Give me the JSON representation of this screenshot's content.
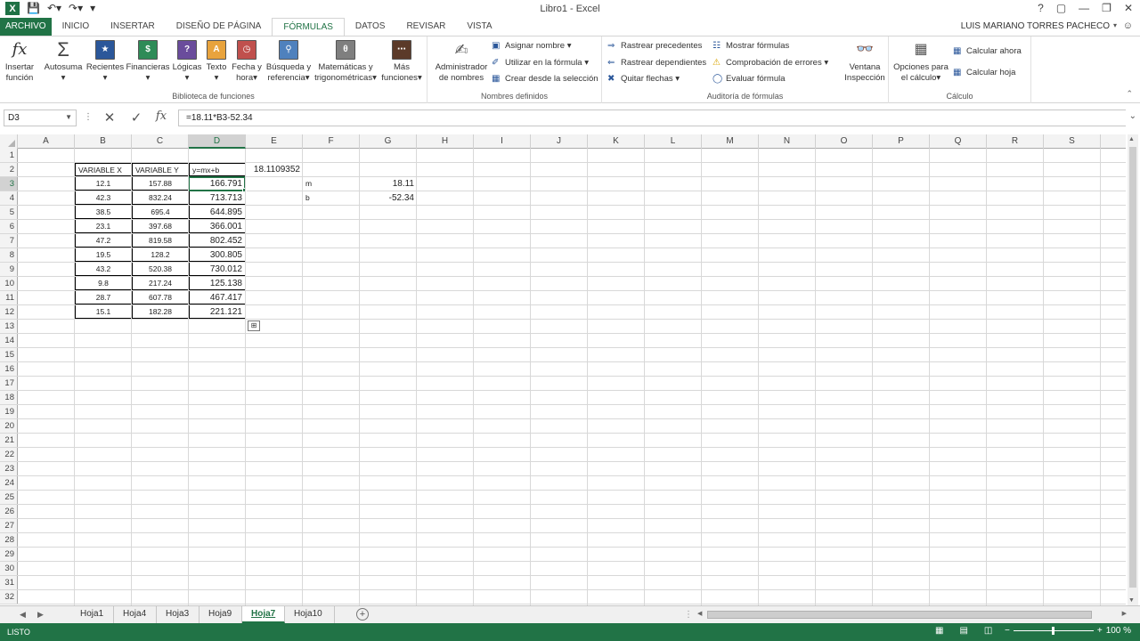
{
  "window": {
    "title": "Libro1 - Excel",
    "controls": [
      "?",
      "▢",
      "—",
      "❐",
      "✕"
    ]
  },
  "qat": {
    "save_icon": "save-icon",
    "undo_icon": "undo-icon",
    "redo_icon": "redo-icon"
  },
  "tabs": {
    "file": "ARCHIVO",
    "items": [
      "INICIO",
      "INSERTAR",
      "DISEÑO DE PÁGINA",
      "FÓRMULAS",
      "DATOS",
      "REVISAR",
      "VISTA"
    ],
    "active": "FÓRMULAS",
    "user": "LUIS MARIANO TORRES PACHECO"
  },
  "ribbon": {
    "biblioteca": {
      "label": "Biblioteca de funciones",
      "insertar": "Insertar función",
      "autosuma": "Autosuma",
      "recientes": "Recientes",
      "financieras": "Financieras",
      "logicas": "Lógicas",
      "texto": "Texto",
      "fecha": "Fecha y hora",
      "busqueda": "Búsqueda y referencia",
      "matematicas": "Matemáticas y trigonométricas",
      "mas": "Más funciones"
    },
    "nombres": {
      "label": "Nombres definidos",
      "administrador": "Administrador de nombres",
      "asignar": "Asignar nombre",
      "utilizar": "Utilizar en la fórmula",
      "crear": "Crear desde la selección"
    },
    "auditoria": {
      "label": "Auditoría de fórmulas",
      "precedentes": "Rastrear precedentes",
      "dependientes": "Rastrear dependientes",
      "quitar": "Quitar flechas",
      "mostrar": "Mostrar fórmulas",
      "comprobacion": "Comprobación de errores",
      "evaluar": "Evaluar fórmula",
      "ventana": "Ventana Inspección"
    },
    "calculo": {
      "label": "Cálculo",
      "opciones": "Opciones para el cálculo",
      "ahora": "Calcular ahora",
      "hoja": "Calcular hoja"
    }
  },
  "formula_bar": {
    "name_box": "D3",
    "formula": "=18.11*B3-52.34"
  },
  "columns": [
    "A",
    "B",
    "C",
    "D",
    "E",
    "F",
    "G",
    "H",
    "I",
    "J",
    "K",
    "L",
    "M",
    "N",
    "O",
    "P",
    "Q",
    "R",
    "S"
  ],
  "selected_column": "D",
  "selected_row": 3,
  "row_count": 32,
  "cells": {
    "B2": "VARIABLE X",
    "C2": "VARIABLE Y",
    "D2": "y=mx+b",
    "E2": "18.1109352",
    "F3": "m",
    "G3": "18.11",
    "F4": "b",
    "G4": "-52.34"
  },
  "table": [
    {
      "row": 3,
      "x": "12.1",
      "y": "157.88",
      "calc": "166.791"
    },
    {
      "row": 4,
      "x": "42.3",
      "y": "832.24",
      "calc": "713.713"
    },
    {
      "row": 5,
      "x": "38.5",
      "y": "695.4",
      "calc": "644.895"
    },
    {
      "row": 6,
      "x": "23.1",
      "y": "397.68",
      "calc": "366.001"
    },
    {
      "row": 7,
      "x": "47.2",
      "y": "819.58",
      "calc": "802.452"
    },
    {
      "row": 8,
      "x": "19.5",
      "y": "128.2",
      "calc": "300.805"
    },
    {
      "row": 9,
      "x": "43.2",
      "y": "520.38",
      "calc": "730.012"
    },
    {
      "row": 10,
      "x": "9.8",
      "y": "217.24",
      "calc": "125.138"
    },
    {
      "row": 11,
      "x": "28.7",
      "y": "607.78",
      "calc": "467.417"
    },
    {
      "row": 12,
      "x": "15.1",
      "y": "182.28",
      "calc": "221.121"
    }
  ],
  "sheets": [
    "Hoja1",
    "Hoja4",
    "Hoja3",
    "Hoja9",
    "Hoja7",
    "Hoja10"
  ],
  "active_sheet": "Hoja7",
  "status": {
    "text": "LISTO",
    "zoom": "100 %"
  }
}
